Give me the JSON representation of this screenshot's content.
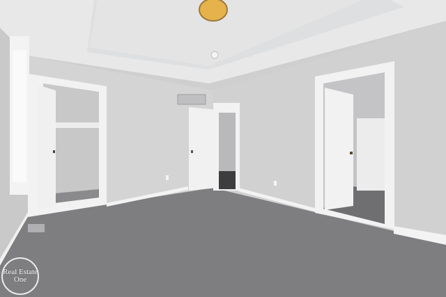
{
  "scene": {
    "description_free": true,
    "colors": {
      "ceiling": "#e9e9ea",
      "wall_left": "#cbcbcc",
      "wall_back": "#d6d6d7",
      "wall_right": "#d2d2d3",
      "carpet": "#7d7d80",
      "trim": "#f4f4f4",
      "door": "#f1f1f1",
      "closet_interior": "#c9c9ca",
      "hall_floor": "#3c3c3e",
      "light_fixture": "#e6b14a"
    },
    "icons": [
      "ceiling-light-icon",
      "smoke-detector-icon",
      "hvac-vent-icon"
    ]
  },
  "watermark": {
    "line1": "Real Estate",
    "line2": "One"
  }
}
